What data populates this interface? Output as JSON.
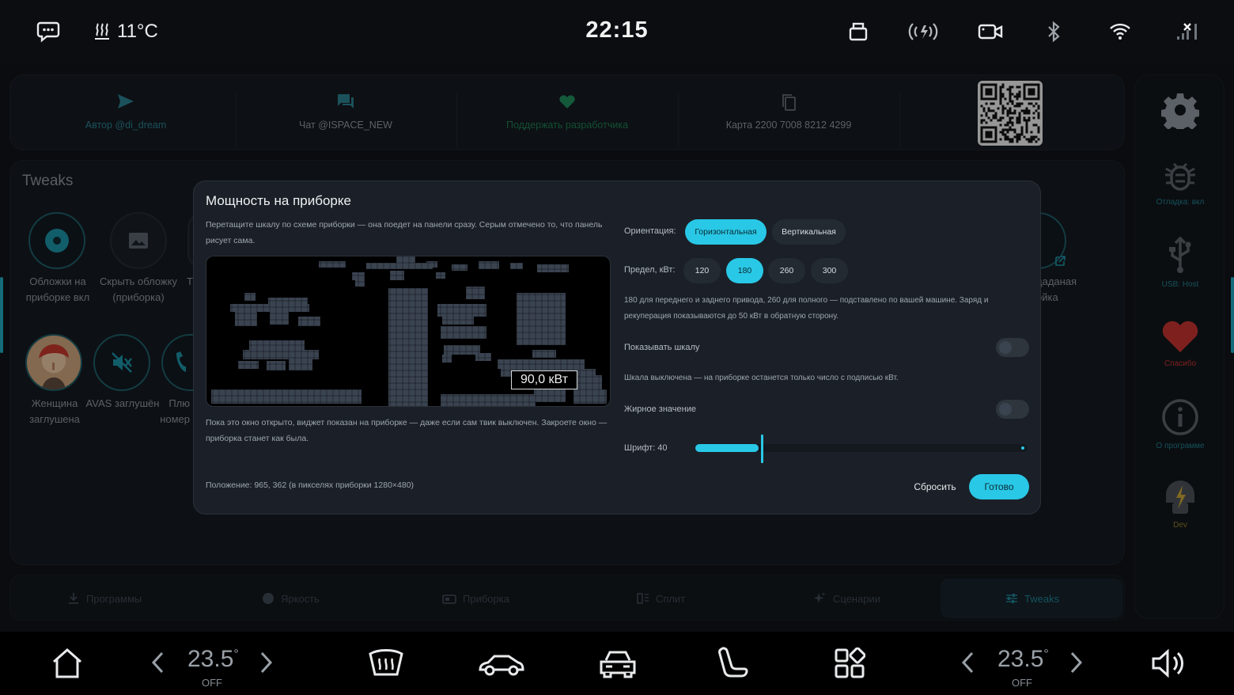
{
  "statusbar": {
    "time": "22:15",
    "outside_temp": "11°C"
  },
  "links": [
    {
      "label": "Автор @di_dream",
      "icon": "send-icon"
    },
    {
      "label": "Чат @ISPACE_NEW",
      "icon": "chat-icon"
    },
    {
      "label": "Поддержать разработчика",
      "icon": "heart-icon"
    },
    {
      "label": "Карта 2200 7008 8212 4299",
      "icon": "copy-icon"
    }
  ],
  "tweaks": {
    "title": "Tweaks",
    "items": [
      {
        "label": "Обложки на приборке вкл",
        "icon": "cover-icon"
      },
      {
        "label": "Скрыть обложку (приборка)",
        "icon": "image-icon"
      },
      {
        "label": "Т",
        "icon": "partial-icon"
      },
      {
        "label": "Женщина заглушена",
        "icon": "avatar-woman"
      },
      {
        "label": "AVAS заглушён",
        "icon": "mute-icon"
      },
      {
        "label": "Плю номер",
        "icon": "phone-icon"
      },
      {
        "label": "даданая ойка",
        "icon": "partial-right-icon"
      }
    ]
  },
  "rail": {
    "items": [
      {
        "label": "",
        "icon": "gear-icon"
      },
      {
        "label": "Отладка: вкл",
        "icon": "bug-icon"
      },
      {
        "label": "USB: Host",
        "icon": "usb-icon"
      },
      {
        "label": "Спасибо",
        "icon": "heart-icon"
      },
      {
        "label": "О программе",
        "icon": "info-icon"
      },
      {
        "label": "Dev",
        "icon": "dev-icon"
      }
    ]
  },
  "tabs": [
    {
      "label": "Программы",
      "icon": "download-icon"
    },
    {
      "label": "Яркость",
      "icon": "brightness-icon"
    },
    {
      "label": "Приборка",
      "icon": "dashboard-icon"
    },
    {
      "label": "Сплит",
      "icon": "split-icon"
    },
    {
      "label": "Сценарии",
      "icon": "sparkle-icon"
    },
    {
      "label": "Tweaks",
      "icon": "sliders-icon"
    }
  ],
  "dock": {
    "left_temp": "23.5",
    "left_temp_deg": "°",
    "left_state": "OFF",
    "right_temp": "23.5",
    "right_temp_deg": "°",
    "right_state": "OFF"
  },
  "dialog": {
    "title": "Мощность на приборке",
    "description": "Перетащите шкалу по схеме приборки — она поедет на панели сразу. Серым отмечено то, что панель рисует сама.",
    "preview_value": "90,0 кВт",
    "note": "Пока это окно открыто, виджет показан на приборке — даже если сам твик выключен. Закроете окно — приборка станет как была.",
    "position": "Положение: 965, 362 (в пикселях приборки 1280×480)",
    "orientation_label": "Ориентация:",
    "orientation_options": [
      "Горизонтальная",
      "Вертикальная"
    ],
    "orientation_selected": "Горизонтальная",
    "limit_label": "Предел, кВт:",
    "limit_options": [
      "120",
      "180",
      "260",
      "300"
    ],
    "limit_selected": "180",
    "limit_desc": "180 для переднего и заднего привода, 260 для полного — подставлено по вашей машине. Заряд и рекуперация показываются до 50 кВт в обратную сторону.",
    "show_scale_label": "Показывать шкалу",
    "show_scale_on": false,
    "scale_off_desc": "Шкала выключена — на приборке останется только число с подписью кВт.",
    "bold_label": "Жирное значение",
    "bold_on": false,
    "font_label": "Шрифт: 40",
    "font_value_fraction": 0.2,
    "reset_label": "Сбросить",
    "done_label": "Готово"
  },
  "colors": {
    "accent": "#29c8e6",
    "accent_dim": "#1f7d8c",
    "background": "#0b0d10"
  }
}
